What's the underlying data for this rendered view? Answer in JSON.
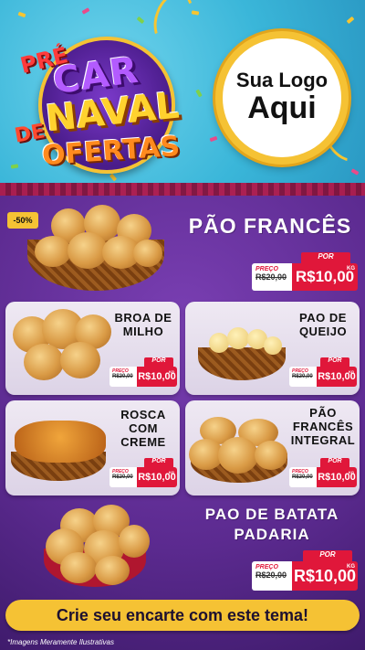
{
  "header": {
    "badge": {
      "pre": "PRÉ",
      "car": "CAR",
      "naval": "NAVAL",
      "de": "DE",
      "ofertas": "OFERTAS"
    },
    "logo_placeholder": {
      "line1": "Sua Logo",
      "line2": "Aqui"
    }
  },
  "featured_top": {
    "discount_badge": "-50%",
    "title": "PÃO FRANCÊS",
    "price": {
      "por": "POR",
      "preco_label": "PREÇO",
      "old": "R$20,00",
      "new": "R$10,00",
      "unit": "KG"
    }
  },
  "cards": [
    {
      "title": "BROA DE MILHO",
      "price": {
        "por": "POR",
        "preco_label": "PREÇO",
        "old": "R$20,00",
        "new": "R$10,00",
        "unit": "KG"
      }
    },
    {
      "title": "PAO DE QUEIJO",
      "price": {
        "por": "POR",
        "preco_label": "PREÇO",
        "old": "R$20,00",
        "new": "R$10,00",
        "unit": "KG"
      }
    },
    {
      "title": "ROSCA COM CREME",
      "price": {
        "por": "POR",
        "preco_label": "PREÇO",
        "old": "R$20,00",
        "new": "R$10,00",
        "unit": "KG"
      }
    },
    {
      "title": "PÃO FRANCÊS INTEGRAL",
      "price": {
        "por": "POR",
        "preco_label": "PREÇO",
        "old": "R$20,00",
        "new": "R$10,00",
        "unit": "KG"
      }
    }
  ],
  "featured_bottom": {
    "title": "PAO DE BATATA PADARIA",
    "price": {
      "por": "POR",
      "preco_label": "PREÇO",
      "old": "R$20,00",
      "new": "R$10,00",
      "unit": "KG"
    }
  },
  "cta": "Crie seu encarte com este tema!",
  "footnote": "*Imagens Meramente Ilustrativas",
  "colors": {
    "sky": "#3ab6d9",
    "purple": "#5b2a8f",
    "gold": "#f5c234",
    "red": "#e0173a"
  }
}
